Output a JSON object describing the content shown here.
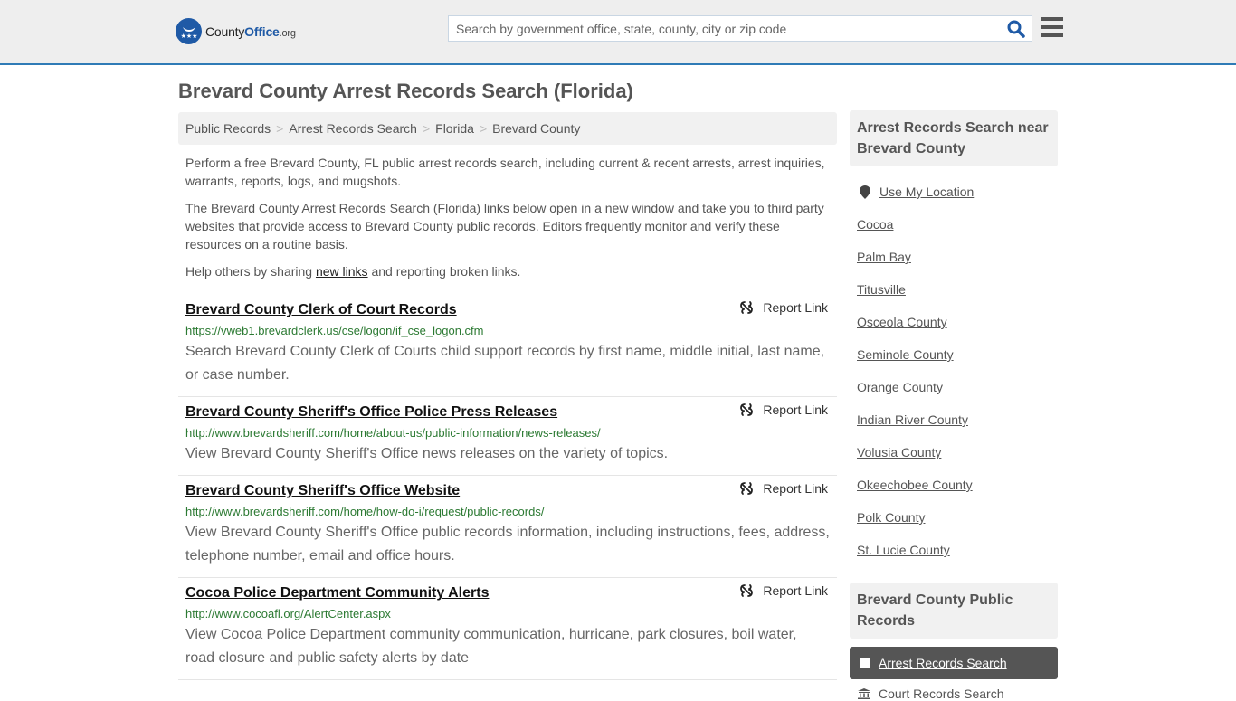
{
  "header": {
    "logo": {
      "county": "County",
      "office": "Office",
      "org": ".org"
    },
    "search": {
      "placeholder": "Search by government office, state, county, city or zip code",
      "value": ""
    },
    "icons": {
      "search": "search-icon",
      "menu": "hamburger-menu-icon"
    },
    "accent_color": "#2f7bb6"
  },
  "page": {
    "title": "Brevard County Arrest Records Search (Florida)"
  },
  "breadcrumb": [
    {
      "label": "Public Records"
    },
    {
      "label": "Arrest Records Search"
    },
    {
      "label": "Florida"
    },
    {
      "label": "Brevard County"
    }
  ],
  "intro": {
    "p1": "Perform a free Brevard County, FL public arrest records search, including current & recent arrests, arrest inquiries, warrants, reports, logs, and mugshots.",
    "p2": "The Brevard County Arrest Records Search (Florida) links below open in a new window and take you to third party websites that provide access to Brevard County public records. Editors frequently monitor and verify these resources on a routine basis.",
    "p3_before": "Help others by sharing ",
    "p3_link": "new links",
    "p3_after": " and reporting broken links."
  },
  "results": [
    {
      "title": "Brevard County Clerk of Court Records",
      "url": "https://vweb1.brevardclerk.us/cse/logon/if_cse_logon.cfm",
      "description": "Search Brevard County Clerk of Courts child support records by first name, middle initial, last name, or case number.",
      "report_label": "Report Link"
    },
    {
      "title": "Brevard County Sheriff's Office Police Press Releases",
      "url": "http://www.brevardsheriff.com/home/about-us/public-information/news-releases/",
      "description": "View Brevard County Sheriff's Office news releases on the variety of topics.",
      "report_label": "Report Link"
    },
    {
      "title": "Brevard County Sheriff's Office Website",
      "url": "http://www.brevardsheriff.com/home/how-do-i/request/public-records/",
      "description": "View Brevard County Sheriff's Office public records information, including instructions, fees, address, telephone number, email and office hours.",
      "report_label": "Report Link"
    },
    {
      "title": "Cocoa Police Department Community Alerts",
      "url": "http://www.cocoafl.org/AlertCenter.aspx",
      "description": "View Cocoa Police Department community communication, hurricane, park closures, boil water, road closure and public safety alerts by date",
      "report_label": "Report Link"
    }
  ],
  "sidebar": {
    "nearby_heading": "Arrest Records Search near Brevard County",
    "use_location": "Use My Location",
    "nearby": [
      "Cocoa",
      "Palm Bay",
      "Titusville",
      "Osceola County",
      "Seminole County",
      "Orange County",
      "Indian River County",
      "Volusia County",
      "Okeechobee County",
      "Polk County",
      "St. Lucie County"
    ],
    "records_heading": "Brevard County Public Records",
    "records_items": [
      {
        "label": "Arrest Records Search",
        "active": true
      },
      {
        "label": "Court Records Search",
        "active": false
      }
    ]
  }
}
